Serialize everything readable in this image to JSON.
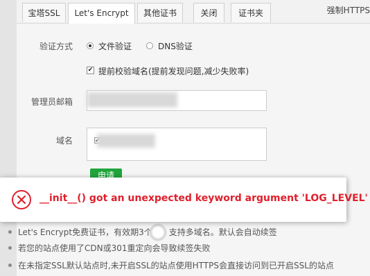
{
  "tabs": [
    {
      "label": "宝塔SSL"
    },
    {
      "label": "Let's Encrypt",
      "active": true
    },
    {
      "label": "其他证书"
    },
    {
      "label": "关闭"
    },
    {
      "label": "证书夹"
    }
  ],
  "tab_force_https": "强制HTTPS",
  "form": {
    "verify_method_label": "验证方式",
    "option_file": "文件验证",
    "option_dns": "DNS验证",
    "selected_option": "文件验证",
    "precheck_label": "提前校验域名(提前发现问题,减少失败率)",
    "precheck_checked": true,
    "admin_email_label": "管理员邮箱",
    "domain_label": "域名",
    "apply_button": "申请"
  },
  "notes": [
    "Let's Encrypt免费证书，有效期3个月，支持多域名。默认会自动续签",
    "若您的站点使用了CDN或301重定向会导致续签失败",
    "在未指定SSL默认站点时,未开启SSL的站点使用HTTPS会直接访问到已开启SSL的站点"
  ],
  "error": {
    "message": "__init__() got an unexpected keyword argument 'LOG_LEVEL'",
    "icon": "error-circle-x-icon",
    "color": "#e0202c"
  },
  "colors": {
    "accent_green": "#20a53a",
    "error_red": "#e0202c"
  }
}
